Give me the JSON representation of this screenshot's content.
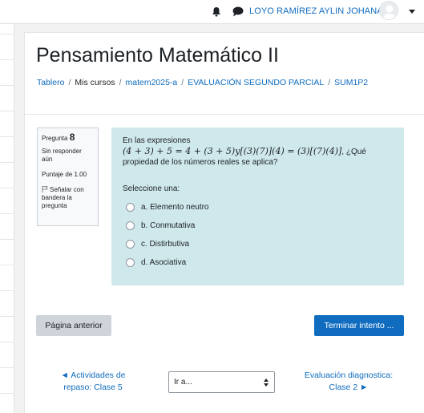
{
  "navbar": {
    "user_name": "LOYO RAMÍREZ AYLIN JOHANA",
    "icons": [
      "bell-icon",
      "chat-icon",
      "avatar",
      "chevron-down-icon"
    ]
  },
  "page": {
    "title": "Pensamiento Matemático II"
  },
  "breadcrumb": {
    "items": [
      "Tablero",
      "Mis cursos",
      "matem2025-a",
      "EVALUACIÓN SEGUNDO PARCIAL",
      "SUM1P2"
    ],
    "separator": "/"
  },
  "question_info": {
    "label": "Pregunta",
    "number": "8",
    "state": "Sin responder aún",
    "grade": "Puntaje de 1.00",
    "flag_label": "Señalar con bandera la pregunta"
  },
  "question": {
    "intro": "En las expresiones",
    "expression": "(4 + 3) + 5 = 4 + (3 + 5)y[(3)(7)](4) = (3)[(7)(4)]",
    "after_expr": ", ¿Qué",
    "text_end": "propiedad de los números reales se aplica?",
    "prompt": "Seleccione una:",
    "options": [
      "a. Elemento neutro",
      "b. Conmutativa",
      "c. Distirbutiva",
      "d. Asociativa"
    ]
  },
  "buttons": {
    "previous": "Página anterior",
    "finish": "Terminar intento ..."
  },
  "activity_nav": {
    "prev_line1": "◄ Actividades de",
    "prev_line2": "repaso: Clase 5",
    "jump_placeholder": "Ir a...",
    "next_line1": "Evaluación diagnostica:",
    "next_line2": "Clase 2 ►"
  },
  "colors": {
    "link": "#0f6cbf",
    "question_bg": "#cfe8ec",
    "primary_button": "#0f6cbf",
    "secondary_button": "#ced4da"
  }
}
